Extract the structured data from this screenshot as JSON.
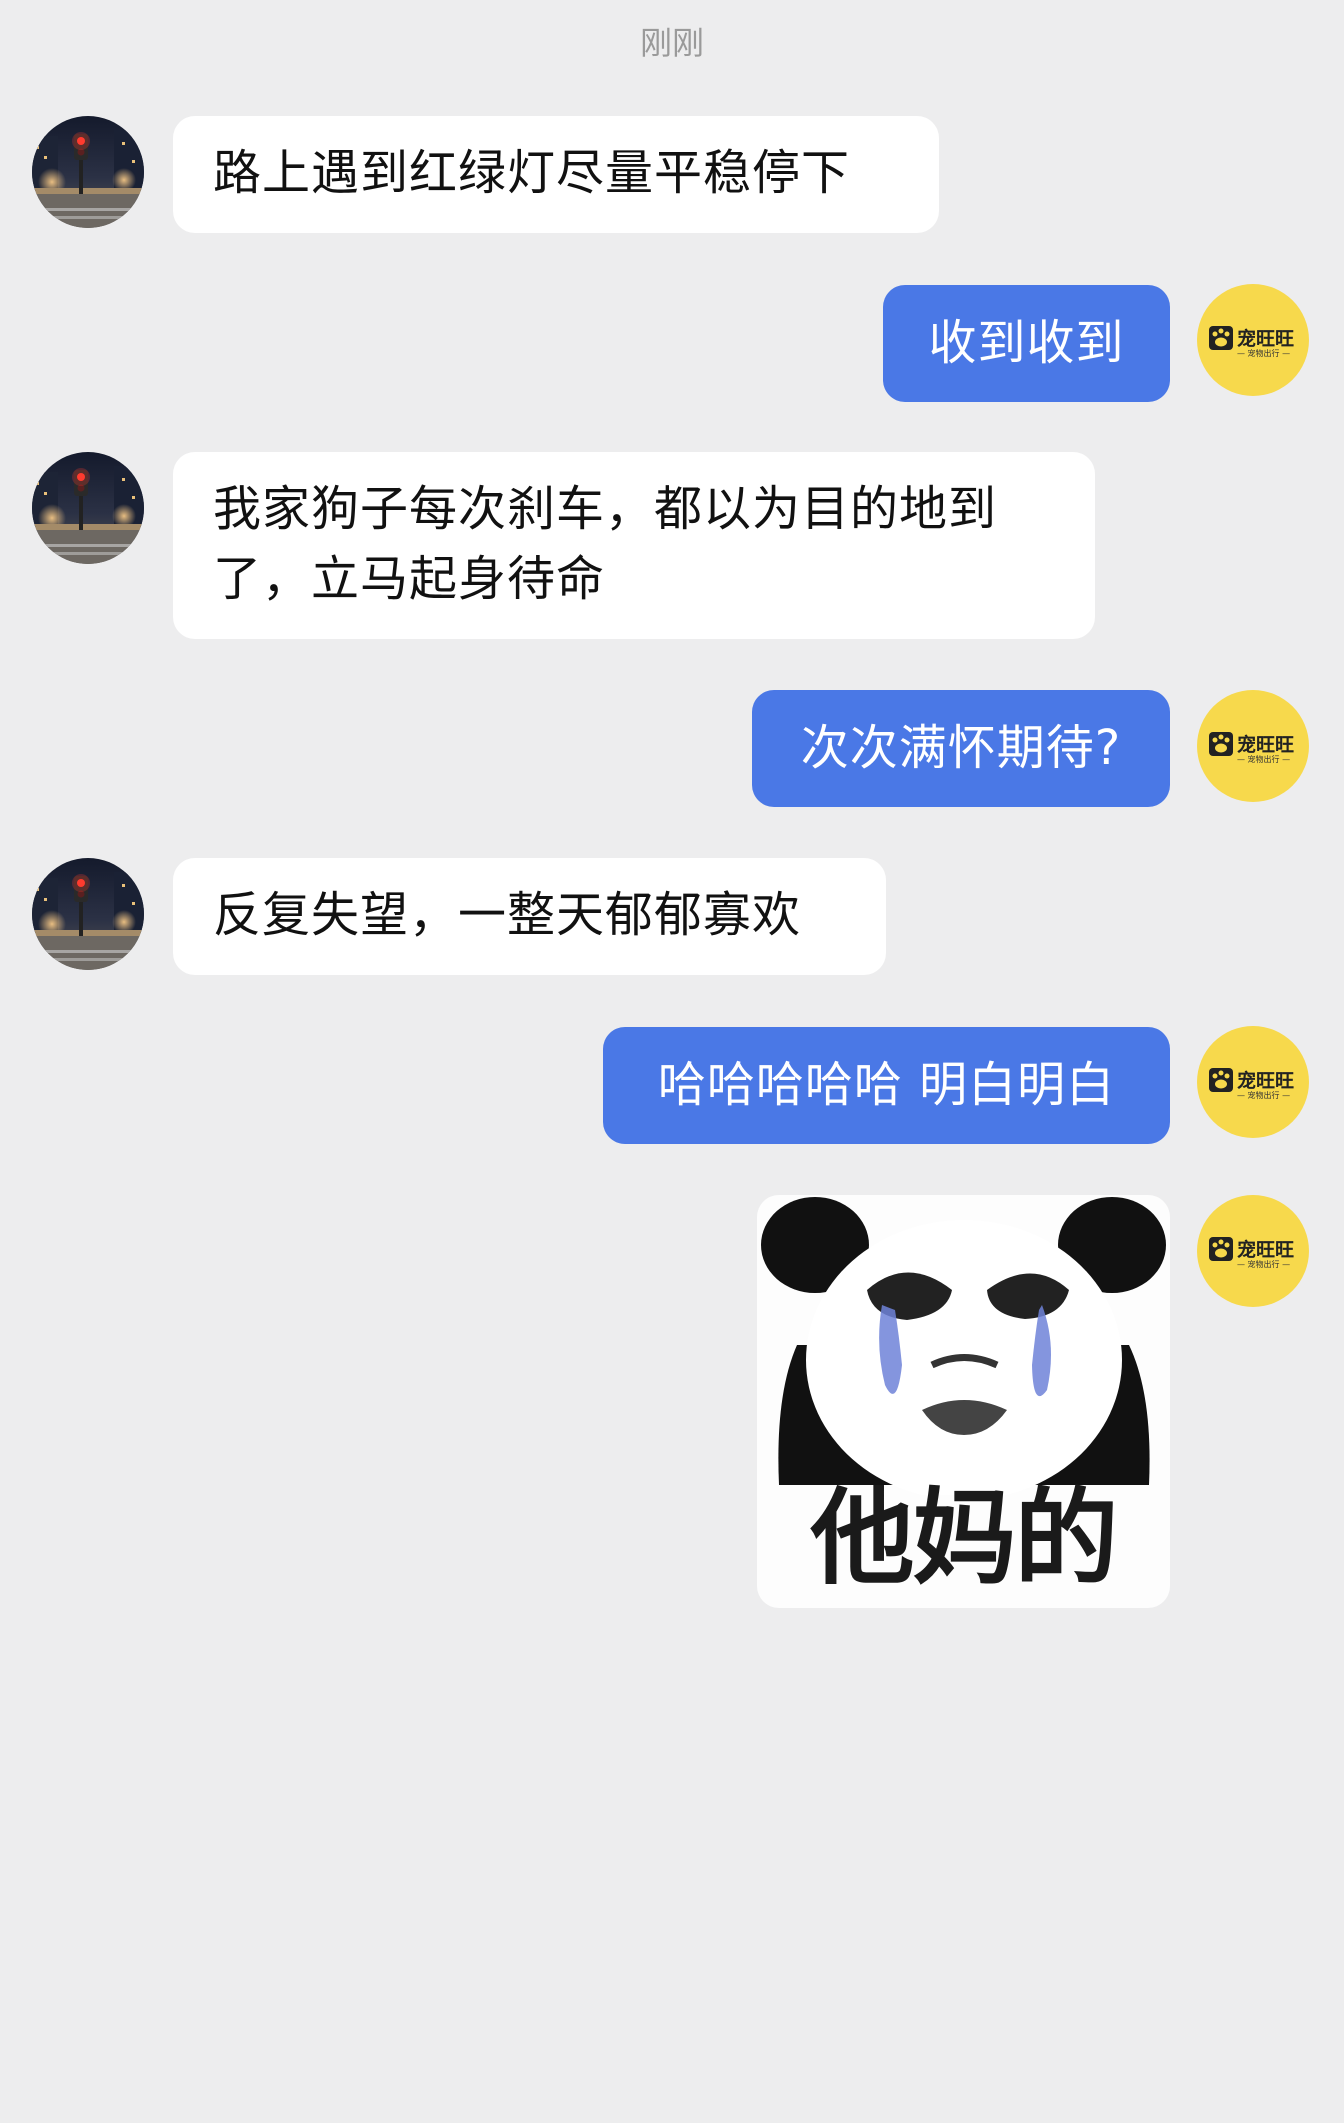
{
  "chat": {
    "timestamp": "刚刚",
    "messages": [
      {
        "side": "left",
        "text": "路上遇到红绿灯尽量平稳停下"
      },
      {
        "side": "right",
        "text": "收到收到"
      },
      {
        "side": "left",
        "lines": [
          "我家狗子每次刹车，都以为目的地到",
          "了，立马起身待命"
        ]
      },
      {
        "side": "right",
        "text": "次次满怀期待?"
      },
      {
        "side": "left",
        "text": "反复失望，一整天郁郁寡欢"
      },
      {
        "side": "right",
        "text": "哈哈哈哈哈 明白明白"
      },
      {
        "side": "right",
        "sticker_caption": "他妈的",
        "sticker_icon": "crying-panda-face"
      }
    ],
    "my_avatar": {
      "brand": "宠旺旺",
      "tagline": "— 宠物出行 —",
      "icon": "paw-logo-icon",
      "color": "#f7d94c"
    },
    "their_avatar": {
      "icon": "night-street-traffic-light-photo"
    },
    "colors": {
      "background": "#ededee",
      "incoming_bubble": "#ffffff",
      "outgoing_bubble": "#4a78e6"
    }
  }
}
